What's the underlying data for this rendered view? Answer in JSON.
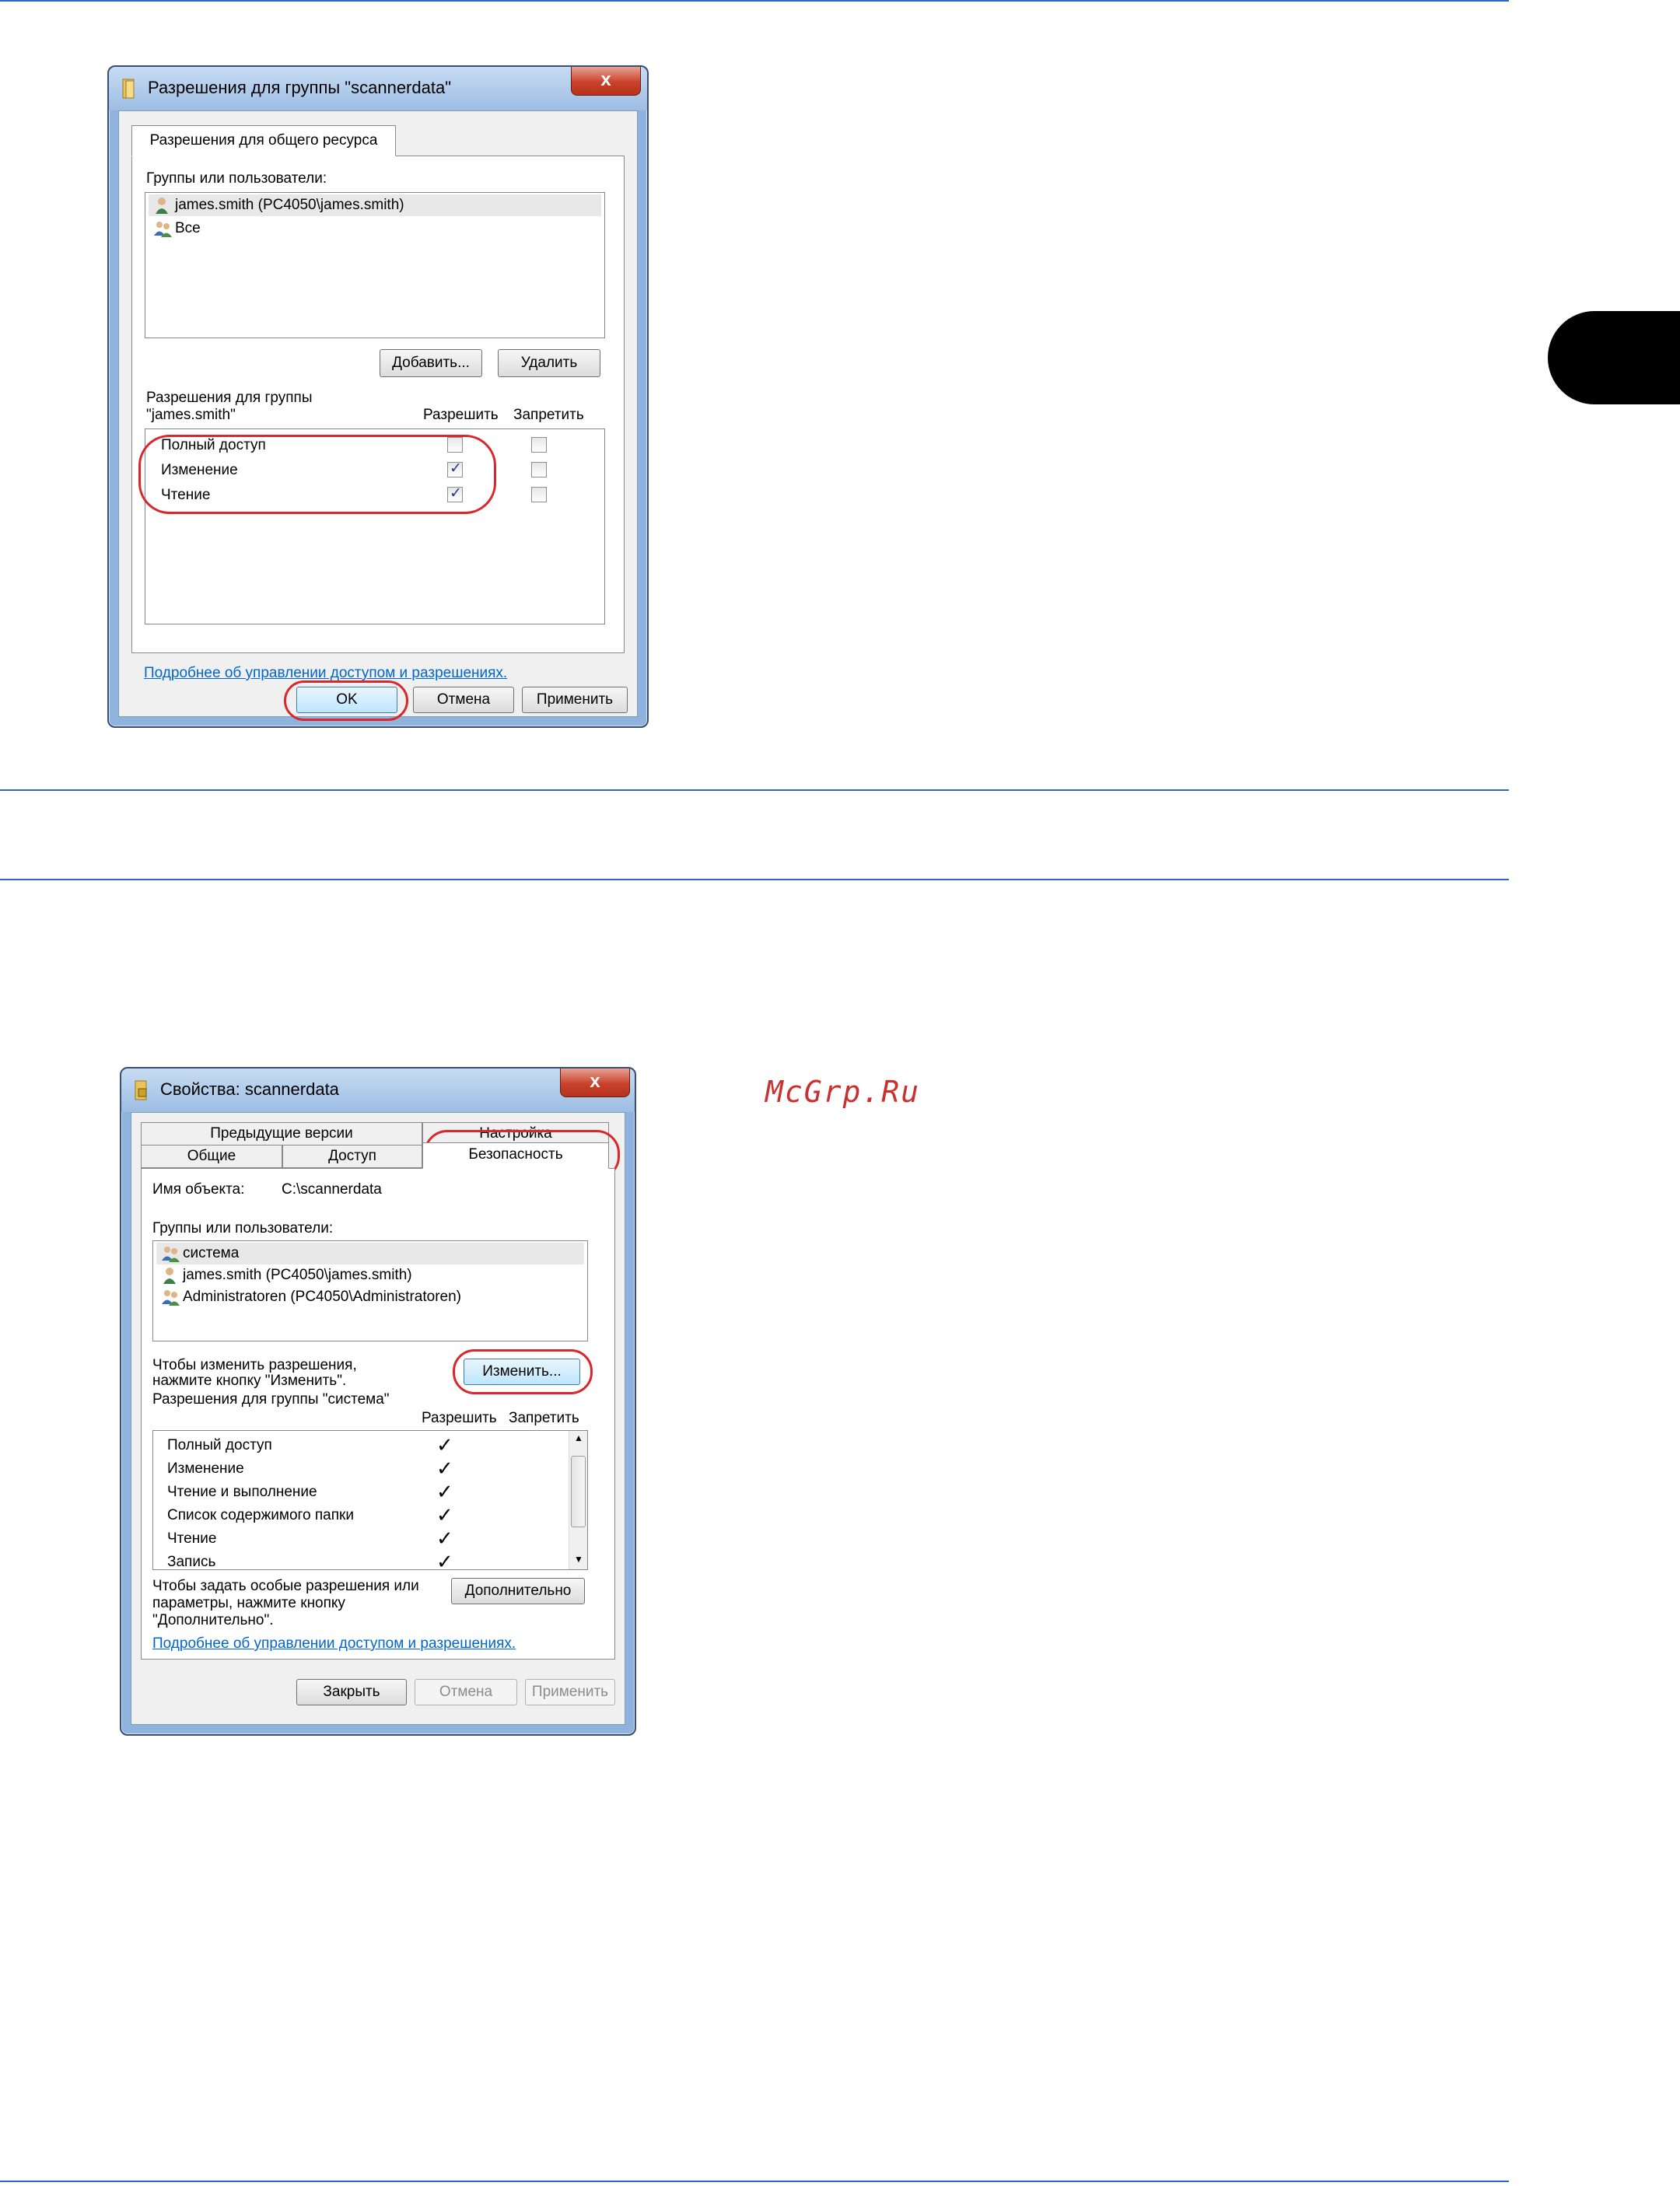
{
  "dialog1": {
    "title": "Разрешения для группы \"scannerdata\"",
    "close_label": "x",
    "tab": "Разрешения для общего ресурса",
    "groups_label": "Группы или пользователи:",
    "users": [
      {
        "name": "james.smith (PC4050\\james.smith)",
        "icon": "user-icon"
      },
      {
        "name": "Все",
        "icon": "users-group-icon"
      }
    ],
    "add_button": "Добавить...",
    "remove_button": "Удалить",
    "perm_label_line1": "Разрешения для группы",
    "perm_label_line2": "\"james.smith\"",
    "col_allow": "Разрешить",
    "col_deny": "Запретить",
    "permissions": [
      {
        "name": "Полный доступ",
        "allow": false,
        "deny": false
      },
      {
        "name": "Изменение",
        "allow": true,
        "deny": false
      },
      {
        "name": "Чтение",
        "allow": true,
        "deny": false
      }
    ],
    "help_link": "Подробнее об управлении доступом и разрешениях.",
    "ok_button": "OK",
    "cancel_button": "Отмена",
    "apply_button": "Применить"
  },
  "dialog2": {
    "title": "Свойства: scannerdata",
    "close_label": "x",
    "tabs_row1": [
      "Предыдущие версии",
      "Настройка"
    ],
    "tabs_row2": [
      "Общие",
      "Доступ",
      "Безопасность"
    ],
    "object_name_label": "Имя объекта:",
    "object_name_value": "C:\\scannerdata",
    "groups_label": "Группы или пользователи:",
    "users": [
      {
        "name": "система",
        "icon": "users-group-icon"
      },
      {
        "name": "james.smith (PC4050\\james.smith)",
        "icon": "user-icon"
      },
      {
        "name": "Administratoren (PC4050\\Administratoren)",
        "icon": "users-group-icon"
      }
    ],
    "change_hint_line1": "Чтобы изменить разрешения,",
    "change_hint_line2": "нажмите кнопку \"Изменить\".",
    "change_button": "Изменить...",
    "perm_label": "Разрешения для группы \"система\"",
    "col_allow": "Разрешить",
    "col_deny": "Запретить",
    "permissions": [
      {
        "name": "Полный доступ",
        "allow": true
      },
      {
        "name": "Изменение",
        "allow": true
      },
      {
        "name": "Чтение и выполнение",
        "allow": true
      },
      {
        "name": "Список содержимого папки",
        "allow": true
      },
      {
        "name": "Чтение",
        "allow": true
      },
      {
        "name": "Запись",
        "allow": true
      }
    ],
    "advanced_hint_line1": "Чтобы задать особые разрешения или",
    "advanced_hint_line2": "параметры, нажмите кнопку",
    "advanced_hint_line3": "\"Дополнительно\".",
    "advanced_button": "Дополнительно",
    "help_link": "Подробнее об управлении доступом и разрешениях.",
    "close_button": "Закрыть",
    "cancel_button": "Отмена",
    "apply_button": "Применить"
  },
  "watermark": "McGrp.Ru",
  "colors": {
    "accent_rule": "#2f66c9",
    "highlight": "#d9272c",
    "link": "#0066cc"
  }
}
